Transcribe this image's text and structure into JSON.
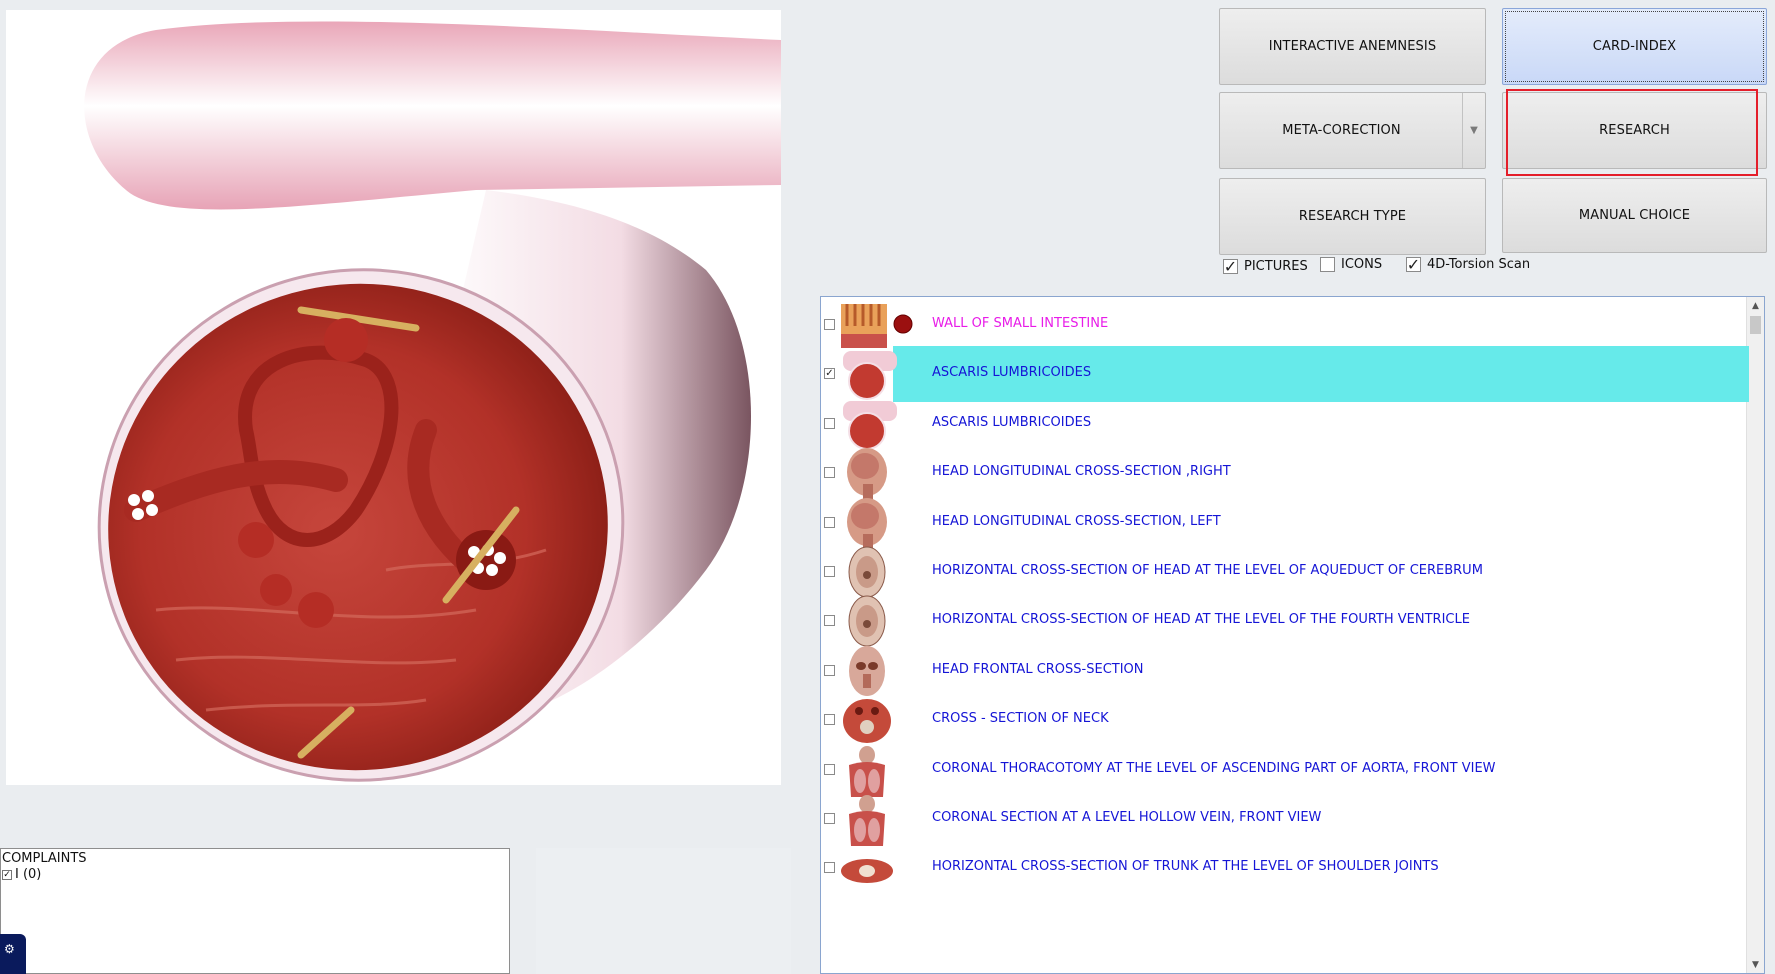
{
  "toolbar": {
    "interactive_anemnesis": "INTERACTIVE ANEMNESIS",
    "card_index": "CARD-INDEX",
    "meta_corection": "META-CORECTION",
    "research": "RESEARCH",
    "research_type": "RESEARCH TYPE",
    "manual_choice": "MANUAL CHOICE"
  },
  "options": {
    "pictures": {
      "label": "PICTURES",
      "checked": true
    },
    "icons": {
      "label": "ICONS",
      "checked": false
    },
    "torsion": {
      "label": "4D-Torsion Scan",
      "checked": true
    }
  },
  "list": {
    "items": [
      {
        "label": "WALL OF SMALL  INTESTINE",
        "checked": false,
        "thumb": "intestine-wall-icon",
        "color": "#e81ce8"
      },
      {
        "label": "ASCARIS  LUMBRICOIDES",
        "checked": true,
        "thumb": "ascaris-icon",
        "selected": true
      },
      {
        "label": "ASCARIS  LUMBRICOIDES",
        "checked": false,
        "thumb": "ascaris-icon"
      },
      {
        "label": "HEAD LONGITUDINAL CROSS-SECTION ,RIGHT",
        "checked": false,
        "thumb": "head-sagittal-icon"
      },
      {
        "label": "HEAD LONGITUDINAL CROSS-SECTION, LEFT",
        "checked": false,
        "thumb": "head-sagittal-icon"
      },
      {
        "label": "HORIZONTAL CROSS-SECTION OF HEAD AT THE LEVEL OF AQUEDUCT OF CEREBRUM",
        "checked": false,
        "thumb": "head-axial-icon"
      },
      {
        "label": "HORIZONTAL CROSS-SECTION OF HEAD AT THE LEVEL OF THE FOURTH VENTRICLE",
        "checked": false,
        "thumb": "head-axial-icon"
      },
      {
        "label": "HEAD FRONTAL CROSS-SECTION",
        "checked": false,
        "thumb": "head-frontal-icon"
      },
      {
        "label": "CROSS - SECTION  OF   NECK",
        "checked": false,
        "thumb": "neck-section-icon"
      },
      {
        "label": "CORONAL THORACOTOMY AT THE LEVEL OF ASCENDING PART OF AORTA, FRONT VIEW",
        "checked": false,
        "thumb": "thorax-icon"
      },
      {
        "label": "CORONAL SECTION AT A LEVEL HOLLOW VEIN, FRONT VIEW",
        "checked": false,
        "thumb": "thorax-icon"
      },
      {
        "label": "HORIZONTAL CROSS-SECTION OF TRUNK AT THE LEVEL OF SHOULDER JOINTS",
        "checked": false,
        "thumb": "trunk-section-icon"
      }
    ]
  },
  "complaints": {
    "title": "COMPLAINTS",
    "item": "I (0)"
  },
  "colors": {
    "selection": "#66eaea",
    "link_blue": "#1515d6",
    "magenta": "#e81ce8",
    "highlight": "#e41e2a"
  }
}
